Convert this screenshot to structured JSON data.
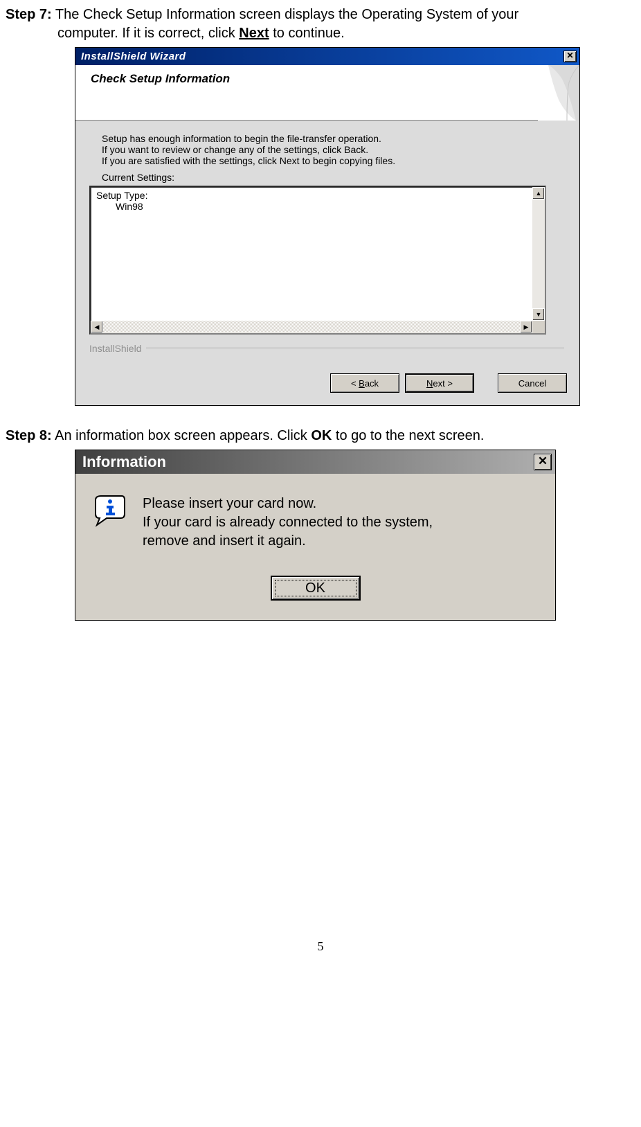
{
  "step7": {
    "label": "Step 7:",
    "text1": " The Check Setup Information screen displays the Operating System of your",
    "text2": "computer. If it is correct, click ",
    "bold": "Next",
    "text3": " to continue."
  },
  "wizard": {
    "title_bar": "InstallShield Wizard",
    "header_title": "Check Setup Information",
    "body_line1": "Setup has enough information to begin the file-transfer operation.",
    "body_line2": "If you want to review or change any of the settings, click Back.",
    "body_line3": "If you are satisfied with the settings, click Next to begin copying files.",
    "label_settings": "Current Settings:",
    "settings_type": "Setup Type:",
    "settings_value": "Win98",
    "brand": "InstallShield",
    "buttons": {
      "back_prefix": "< ",
      "back_mnemonic": "B",
      "back_rest": "ack",
      "next_mnemonic": "N",
      "next_rest": "ext >",
      "cancel": "Cancel"
    }
  },
  "step8": {
    "label": "Step 8:",
    "text1": " An information box screen appears. Click ",
    "bold": "OK",
    "text2": " to go to the next screen."
  },
  "info": {
    "title": "Information",
    "line1": "Please insert your card now.",
    "line2": "If your card is already connected to the system,",
    "line3": "remove and insert it again.",
    "ok": "OK"
  },
  "page_number": "5"
}
